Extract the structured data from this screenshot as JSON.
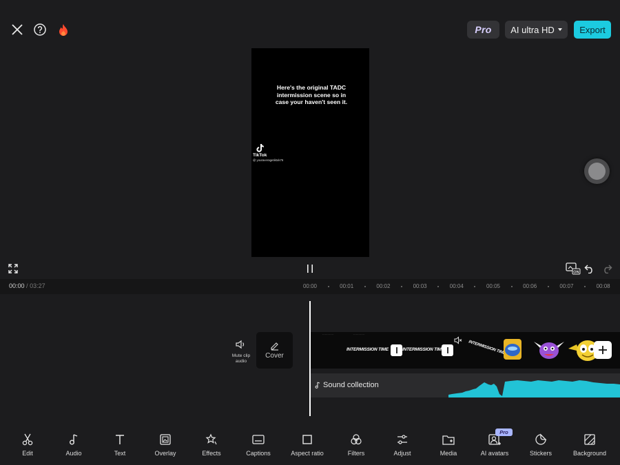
{
  "top_bar": {
    "close_icon": "close-icon",
    "help_icon": "help-icon",
    "fire_icon": "fire-icon",
    "pro_label": "Pro",
    "quality_label": "AI ultra HD",
    "export_label": "Export",
    "colors": {
      "export_bg": "#1ccbe0",
      "fire": "#ff4a2e"
    }
  },
  "preview": {
    "overlay_text": "Here's the original TADC intermission scene so in case your haven't seen it.",
    "watermark_brand": "TikTok",
    "watermark_user": "@ youraveragetiktok76"
  },
  "controls": {
    "current_time": "00:00",
    "separator": "/",
    "total_time": "03:27",
    "ruler": [
      "00:00",
      "00:01",
      "00:02",
      "00:03",
      "00:04",
      "00:05",
      "00:06",
      "00:07",
      "00:08"
    ]
  },
  "timeline": {
    "mute_label": "Mute clip audio",
    "cover_label": "Cover",
    "frame_caption": "INTERMISSION TIME",
    "audio_label": "Sound collection",
    "colors": {
      "waveform": "#22c3d6"
    }
  },
  "toolbar": [
    {
      "label": "Edit",
      "icon": "scissors-icon"
    },
    {
      "label": "Audio",
      "icon": "music-note-icon"
    },
    {
      "label": "Text",
      "icon": "text-icon"
    },
    {
      "label": "Overlay",
      "icon": "overlay-icon"
    },
    {
      "label": "Effects",
      "icon": "effects-icon"
    },
    {
      "label": "Captions",
      "icon": "captions-icon"
    },
    {
      "label": "Aspect ratio",
      "icon": "aspect-ratio-icon"
    },
    {
      "label": "Filters",
      "icon": "filters-icon"
    },
    {
      "label": "Adjust",
      "icon": "adjust-icon"
    },
    {
      "label": "Media",
      "icon": "media-icon"
    },
    {
      "label": "AI avatars",
      "icon": "ai-avatars-icon",
      "badge": "Pro"
    },
    {
      "label": "Stickers",
      "icon": "stickers-icon"
    },
    {
      "label": "Background",
      "icon": "background-icon"
    }
  ]
}
